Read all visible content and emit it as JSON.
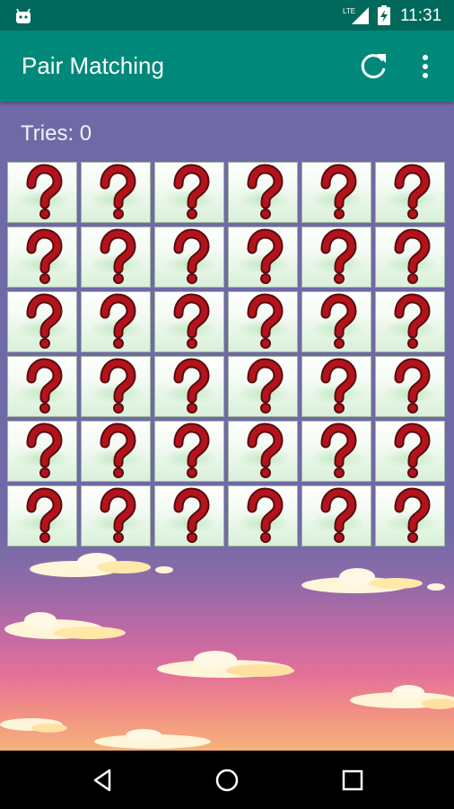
{
  "status_bar": {
    "time": "11:31",
    "network_label": "LTE",
    "icons": [
      "android-icon",
      "lte-signal-icon",
      "battery-charging-icon"
    ]
  },
  "app_bar": {
    "title": "Pair Matching",
    "actions": [
      "refresh-icon",
      "overflow-menu-icon"
    ]
  },
  "game": {
    "tries_label": "Tries:",
    "tries_count": "0",
    "rows": 6,
    "columns": 6,
    "card_state": "face-down",
    "card_symbol": "?"
  },
  "nav_bar": {
    "buttons": [
      "back-icon",
      "home-icon",
      "recents-icon"
    ]
  },
  "colors": {
    "status_bar": "#00695c",
    "app_bar": "#00897b",
    "background_top": "#6f6aa6",
    "question_mark": "#b3141c"
  }
}
